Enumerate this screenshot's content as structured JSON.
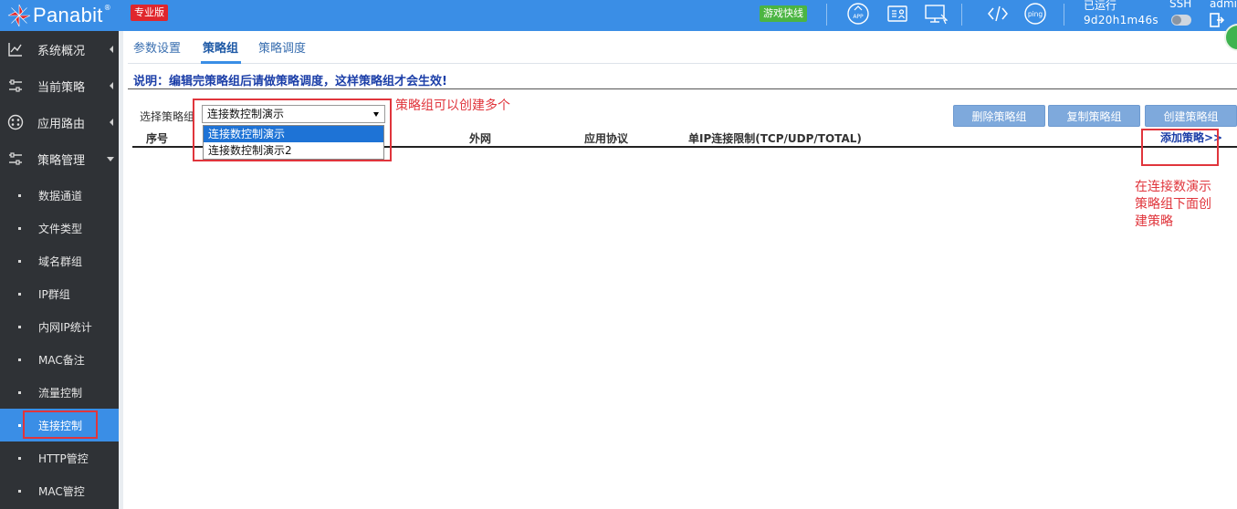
{
  "topbar": {
    "logo_text": "Panabit",
    "logo_reg": "®",
    "edition": "专业版",
    "game_badge": "游戏快线",
    "uptime_label": "已运行",
    "uptime_value": "9d20h1m46s",
    "ssh_label": "SSH",
    "admin_label": "admin",
    "icons": [
      "app-icon",
      "report-icon",
      "monitor-icon",
      "code-icon",
      "ping-icon"
    ],
    "ping_text": "ping",
    "app_text": "APP",
    "brand_color": "#3a8ee6"
  },
  "sidebar": {
    "items": [
      {
        "label": "系统概况",
        "icon": "chart-icon"
      },
      {
        "label": "当前策略",
        "icon": "sliders-icon"
      },
      {
        "label": "应用路由",
        "icon": "route-icon"
      },
      {
        "label": "策略管理",
        "icon": "policy-icon"
      }
    ],
    "subitems": [
      {
        "label": "数据通道"
      },
      {
        "label": "文件类型"
      },
      {
        "label": "域名群组"
      },
      {
        "label": "IP群组"
      },
      {
        "label": "内网IP统计"
      },
      {
        "label": "MAC备注"
      },
      {
        "label": "流量控制"
      },
      {
        "label": "连接控制",
        "active": true
      },
      {
        "label": "HTTP管控"
      },
      {
        "label": "MAC管控"
      }
    ]
  },
  "main": {
    "tabs": [
      {
        "label": "参数设置"
      },
      {
        "label": "策略组",
        "active": true
      },
      {
        "label": "策略调度"
      }
    ],
    "notice": "说明：编辑完策略组后请做策略调度，这样策略组才会生效!",
    "group_label": "选择策略组",
    "select_value": "连接数控制演示",
    "options": [
      "连接数控制演示",
      "连接数控制演示2"
    ],
    "buttons": {
      "delete": "删除策略组",
      "copy": "复制策略组",
      "create": "创建策略组"
    },
    "columns": {
      "seq": "序号",
      "wan": "外网",
      "proto": "应用协议",
      "limit": "单IP连接限制(TCP/UDP/TOTAL)"
    },
    "add_link": "添加策略>>"
  },
  "annotations": {
    "dropdown_note": "策略组可以创建多个",
    "add_note_lines": [
      "在连接数演示",
      "策略组下面创",
      "建策略"
    ],
    "color": "#e0353c"
  }
}
